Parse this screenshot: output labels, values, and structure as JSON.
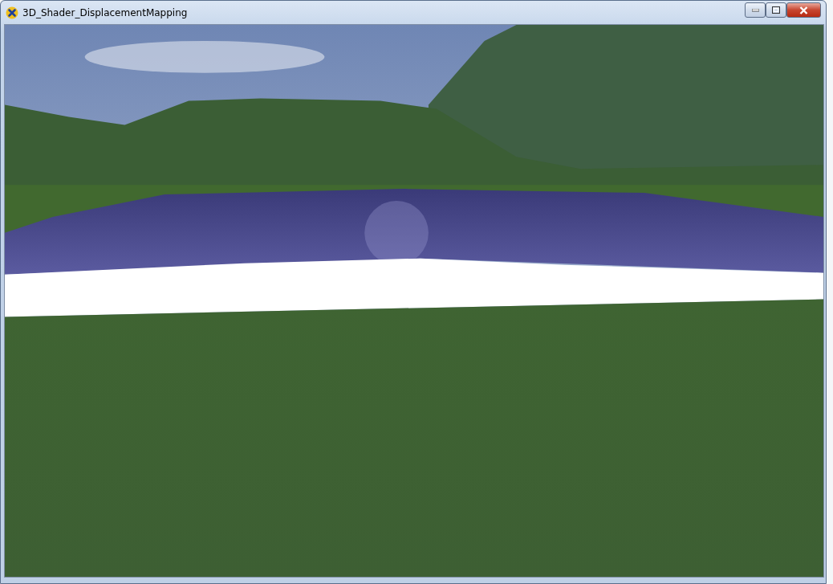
{
  "window": {
    "title": "3D_Shader_DisplacementMapping"
  }
}
